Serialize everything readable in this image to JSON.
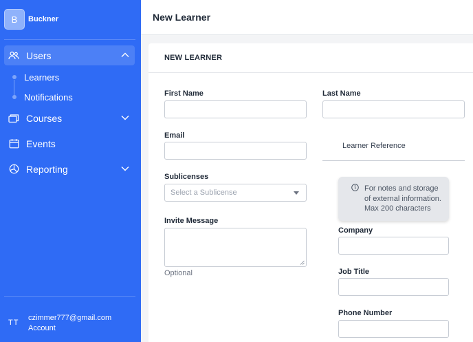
{
  "brand": {
    "initial": "B",
    "name": "Buckner"
  },
  "sidebar": {
    "items": [
      {
        "label": "Users",
        "icon": "users-icon",
        "active": true,
        "expanded": true
      },
      {
        "label": "Courses",
        "icon": "courses-icon",
        "expanded": false
      },
      {
        "label": "Events",
        "icon": "calendar-icon"
      },
      {
        "label": "Reporting",
        "icon": "pie-chart-icon",
        "expanded": false
      }
    ],
    "sub_items": [
      {
        "label": "Learners"
      },
      {
        "label": "Notifications"
      }
    ]
  },
  "account": {
    "initials": "TT",
    "email": "czimmer777@gmail.com",
    "label": "Account"
  },
  "header": {
    "title": "New Learner"
  },
  "form": {
    "section_title": "NEW LEARNER",
    "first_name": {
      "label": "First Name",
      "value": ""
    },
    "last_name": {
      "label": "Last Name",
      "value": ""
    },
    "email": {
      "label": "Email",
      "value": ""
    },
    "learner_reference": {
      "label": "Learner Reference"
    },
    "sublicenses": {
      "label": "Sublicenses",
      "placeholder": "Select a Sublicense"
    },
    "invite_message": {
      "label": "Invite Message",
      "help": "Optional"
    },
    "tooltip": {
      "text": "For notes and storage of external information. Max 200 characters"
    },
    "company": {
      "label": "Company",
      "value": ""
    },
    "job_title": {
      "label": "Job Title",
      "value": ""
    },
    "phone_number": {
      "label": "Phone Number",
      "value": ""
    }
  },
  "colors": {
    "sidebar_bg": "#2f6bf5",
    "active_item_bg": "#4c80f6",
    "page_bg": "#f3f4f6"
  }
}
